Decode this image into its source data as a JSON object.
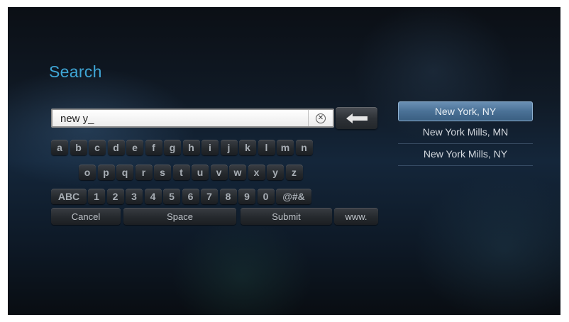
{
  "title": "Search",
  "search": {
    "value": "new y_"
  },
  "icons": {
    "clear": "clear-circle-x-icon",
    "backspace": "backspace-arrow-icon"
  },
  "keyboard": {
    "row1": [
      "a",
      "b",
      "c",
      "d",
      "e",
      "f",
      "g",
      "h",
      "i",
      "j",
      "k",
      "l",
      "m",
      "n"
    ],
    "row2": [
      "o",
      "p",
      "q",
      "r",
      "s",
      "t",
      "u",
      "v",
      "w",
      "x",
      "y",
      "z"
    ],
    "row3": [
      "ABC",
      "1",
      "2",
      "3",
      "4",
      "5",
      "6",
      "7",
      "8",
      "9",
      "0",
      "@#&"
    ],
    "actions": {
      "cancel": "Cancel",
      "space": "Space",
      "submit": "Submit",
      "www": "www."
    }
  },
  "suggestions": [
    {
      "label": "New York, NY",
      "selected": true
    },
    {
      "label": "New York Mills, MN",
      "selected": false
    },
    {
      "label": "New York Mills, NY",
      "selected": false
    }
  ],
  "colors": {
    "accent": "#3fa6d6",
    "selected": "#4a7196"
  }
}
